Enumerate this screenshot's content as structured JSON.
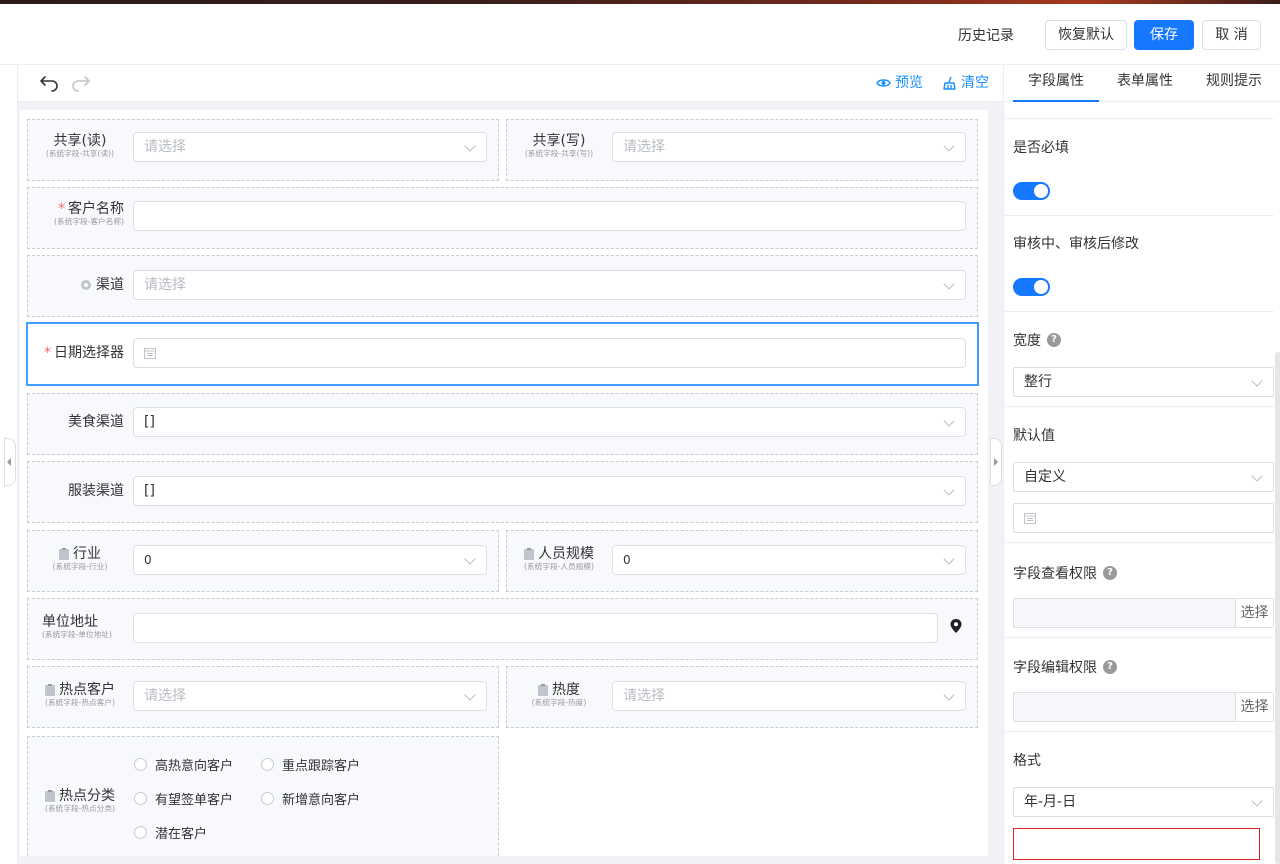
{
  "header": {
    "history": "历史记录",
    "restore": "恢复默认",
    "save": "保存",
    "cancel": "取 消"
  },
  "toolbar": {
    "preview": "预览",
    "clear": "清空"
  },
  "form": {
    "share_read": {
      "label": "共享(读)",
      "sub": "(系统字段-共享(读))",
      "placeholder": "请选择"
    },
    "share_write": {
      "label": "共享(写)",
      "sub": "(系统字段-共享(写))",
      "placeholder": "请选择"
    },
    "customer_name": {
      "label": "客户名称",
      "sub": "(系统字段-客户名称)"
    },
    "channel": {
      "label": "渠道",
      "placeholder": "请选择"
    },
    "date_picker": {
      "label": "日期选择器"
    },
    "food_channel": {
      "label": "美食渠道",
      "value": "[]"
    },
    "clothing_channel": {
      "label": "服装渠道",
      "value": "[]"
    },
    "industry": {
      "label": "行业",
      "sub": "(系统字段-行业)",
      "value": "0"
    },
    "staff_size": {
      "label": "人员规模",
      "sub": "(系统字段-人员规模)",
      "value": "0"
    },
    "address": {
      "label": "单位地址",
      "sub": "(系统字段-单位地址)"
    },
    "hot_customer": {
      "label": "热点客户",
      "sub": "(系统字段-热点客户)",
      "placeholder": "请选择"
    },
    "heat": {
      "label": "热度",
      "sub": "(系统字段-热度)",
      "placeholder": "请选择"
    },
    "hot_category": {
      "label": "热点分类",
      "sub": "(系统字段-热点分类)",
      "options": [
        "高热意向客户",
        "重点跟踪客户",
        "有望签单客户",
        "新增意向客户",
        "潜在客户"
      ]
    }
  },
  "panel": {
    "tabs": [
      "字段属性",
      "表单属性",
      "规则提示"
    ],
    "required": "是否必填",
    "edit_in_review": "审核中、审核后修改",
    "width_label": "宽度",
    "width_value": "整行",
    "default_label": "默认值",
    "default_value": "自定义",
    "view_perm": "字段查看权限",
    "edit_perm": "字段编辑权限",
    "select_btn": "选择",
    "format_label": "格式",
    "format_value": "年-月-日"
  }
}
